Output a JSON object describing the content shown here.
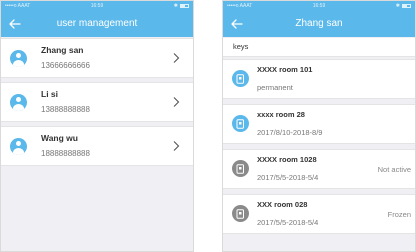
{
  "colors": {
    "accent": "#5bb8ea",
    "inactive_icon": "#8a8a8a",
    "background": "#efeff4"
  },
  "left": {
    "status": {
      "carrier": "•••••o AAAT",
      "time": "16:59"
    },
    "title": "user management",
    "back_icon": "arrow-left-icon",
    "users": [
      {
        "name": "Zhang san",
        "phone": "13666666666"
      },
      {
        "name": "Li si",
        "phone": "13888888888"
      },
      {
        "name": "Wang wu",
        "phone": "18888888888"
      }
    ]
  },
  "right": {
    "status": {
      "carrier": "•••••o AAAT",
      "time": "16:59"
    },
    "title": "Zhang san",
    "back_icon": "arrow-left-icon",
    "section_label": "keys",
    "keys": [
      {
        "name": "XXXX room 101",
        "sub": "permanent",
        "status": "",
        "icon_color": "#5bb8ea"
      },
      {
        "name": "xxxx room 28",
        "sub": "2017/8/10-2018-8/9",
        "status": "",
        "icon_color": "#5bb8ea"
      },
      {
        "name": "XXXX room 1028",
        "sub": "2017/5/5-2018-5/4",
        "status": "Not active",
        "icon_color": "#8a8a8a"
      },
      {
        "name": "XXX room 028",
        "sub": "2017/5/5-2018-5/4",
        "status": "Frozen",
        "icon_color": "#8a8a8a"
      }
    ]
  }
}
